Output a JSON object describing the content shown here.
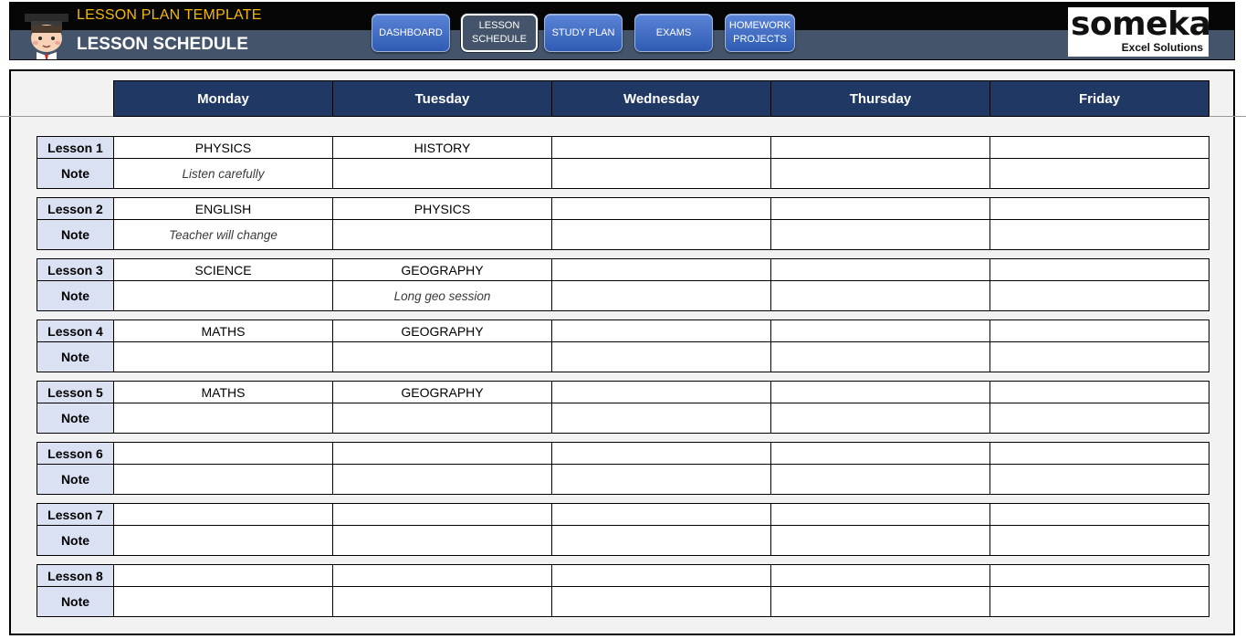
{
  "header": {
    "app_title": "LESSON PLAN TEMPLATE",
    "page_title": "LESSON SCHEDULE",
    "nav": [
      {
        "label": "DASHBOARD",
        "active": false
      },
      {
        "label": "LESSON\nSCHEDULE",
        "active": true
      },
      {
        "label": "STUDY PLAN",
        "active": false
      },
      {
        "label": "EXAMS",
        "active": false
      },
      {
        "label": "HOMEWORK\nPROJECTS",
        "active": false
      }
    ],
    "logo": {
      "word": "someka",
      "subtitle": "Excel Solutions"
    }
  },
  "colors": {
    "header_top": "#060606",
    "header_bottom": "#44546a",
    "app_title": "#f5b800",
    "day_header": "#1f3864",
    "label_fill": "#dae1f3",
    "button_blue": "#3a66c0"
  },
  "days": [
    "Monday",
    "Tuesday",
    "Wednesday",
    "Thursday",
    "Friday"
  ],
  "note_label": "Note",
  "lessons": [
    {
      "label": "Lesson 1",
      "subjects": [
        "PHYSICS",
        "HISTORY",
        "",
        "",
        ""
      ],
      "notes": [
        "Listen carefully",
        "",
        "",
        "",
        ""
      ]
    },
    {
      "label": "Lesson 2",
      "subjects": [
        "ENGLISH",
        "PHYSICS",
        "",
        "",
        ""
      ],
      "notes": [
        "Teacher will change",
        "",
        "",
        "",
        ""
      ]
    },
    {
      "label": "Lesson 3",
      "subjects": [
        "SCIENCE",
        "GEOGRAPHY",
        "",
        "",
        ""
      ],
      "notes": [
        "",
        "Long geo session",
        "",
        "",
        ""
      ]
    },
    {
      "label": "Lesson 4",
      "subjects": [
        "MATHS",
        "GEOGRAPHY",
        "",
        "",
        ""
      ],
      "notes": [
        "",
        "",
        "",
        "",
        ""
      ]
    },
    {
      "label": "Lesson 5",
      "subjects": [
        "MATHS",
        "GEOGRAPHY",
        "",
        "",
        ""
      ],
      "notes": [
        "",
        "",
        "",
        "",
        ""
      ]
    },
    {
      "label": "Lesson 6",
      "subjects": [
        "",
        "",
        "",
        "",
        ""
      ],
      "notes": [
        "",
        "",
        "",
        "",
        ""
      ]
    },
    {
      "label": "Lesson 7",
      "subjects": [
        "",
        "",
        "",
        "",
        ""
      ],
      "notes": [
        "",
        "",
        "",
        "",
        ""
      ]
    },
    {
      "label": "Lesson 8",
      "subjects": [
        "",
        "",
        "",
        "",
        ""
      ],
      "notes": [
        "",
        "",
        "",
        "",
        ""
      ]
    }
  ]
}
